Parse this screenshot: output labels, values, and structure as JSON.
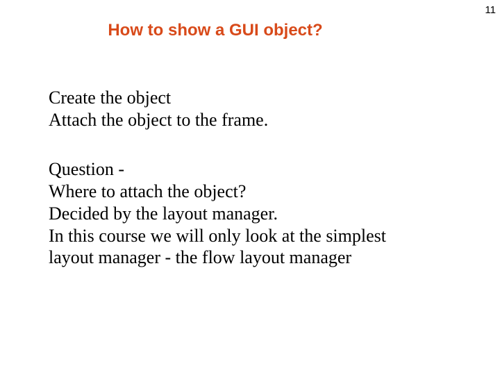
{
  "page_number": "11",
  "title": "How to show a GUI object?",
  "block1": {
    "line1": "Create the object",
    "line2": "Attach the object to the frame."
  },
  "block2": {
    "line1": "Question -",
    "line2": "Where to attach the object?",
    "line3": "Decided  by the layout manager.",
    "line4": "In this course we will only look at the simplest",
    "line5": "layout manager - the flow layout manager"
  }
}
